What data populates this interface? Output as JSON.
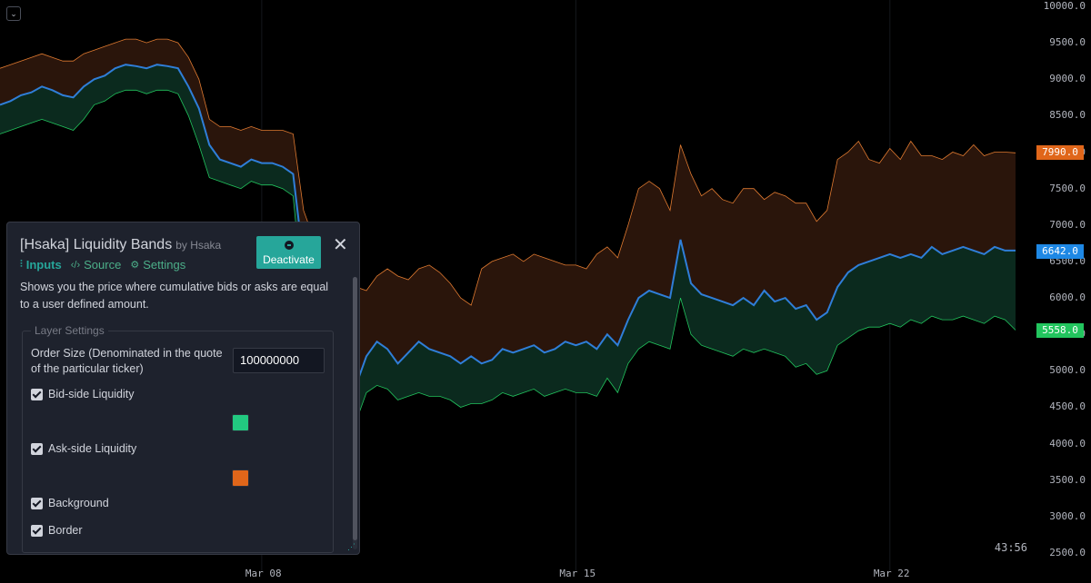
{
  "chart_data": {
    "type": "line",
    "series": [
      {
        "values": [
          8650,
          8700,
          8780,
          8820,
          8900,
          8850,
          8780,
          8750,
          8900,
          9000,
          9050,
          9150,
          9200,
          9180,
          9150,
          9200,
          9180,
          9150,
          8900,
          8600,
          8100,
          7900,
          7850,
          7800,
          7900,
          7850,
          7850,
          7800,
          7700,
          6500,
          5900,
          5500,
          5000,
          4200,
          4800,
          5200,
          5400,
          5300,
          5100,
          5250,
          5400,
          5300,
          5250,
          5200,
          5100,
          5200,
          5100,
          5150,
          5300,
          5250,
          5300,
          5350,
          5250,
          5300,
          5400,
          5350,
          5400,
          5300,
          5500,
          5350,
          5700,
          6000,
          6100,
          6050,
          6000,
          6800,
          6200,
          6050,
          6000,
          5950,
          5900,
          6000,
          5900,
          6100,
          5950,
          6000,
          5850,
          5900,
          5700,
          5800,
          6150,
          6350,
          6450,
          6500,
          6550,
          6600,
          6550,
          6600,
          6550,
          6700,
          6600,
          6650,
          6700,
          6650,
          6600,
          6700,
          6650,
          6650
        ]
      },
      {
        "values": [
          9150,
          9200,
          9250,
          9300,
          9350,
          9300,
          9250,
          9250,
          9350,
          9400,
          9450,
          9500,
          9550,
          9550,
          9500,
          9550,
          9550,
          9500,
          9300,
          9000,
          8450,
          8350,
          8350,
          8300,
          8350,
          8300,
          8300,
          8300,
          8250,
          7200,
          6800,
          6700,
          6550,
          6000,
          6150,
          6100,
          6300,
          6400,
          6300,
          6250,
          6400,
          6450,
          6350,
          6200,
          6000,
          5900,
          6400,
          6500,
          6550,
          6600,
          6500,
          6600,
          6550,
          6500,
          6450,
          6450,
          6400,
          6600,
          6700,
          6550,
          7000,
          7500,
          7600,
          7500,
          7200,
          8100,
          7700,
          7400,
          7500,
          7350,
          7300,
          7500,
          7500,
          7350,
          7450,
          7400,
          7300,
          7300,
          7050,
          7200,
          7900,
          8000,
          8150,
          7900,
          7850,
          8050,
          7900,
          8150,
          7950,
          7950,
          7900,
          8000,
          7950,
          8100,
          7950,
          8000,
          8000,
          7990
        ]
      },
      {
        "values": [
          8250,
          8300,
          8350,
          8400,
          8450,
          8400,
          8350,
          8300,
          8450,
          8650,
          8700,
          8800,
          8850,
          8850,
          8800,
          8850,
          8850,
          8800,
          8500,
          8100,
          7650,
          7600,
          7550,
          7500,
          7600,
          7550,
          7550,
          7500,
          7400,
          5900,
          5100,
          4850,
          4600,
          3400,
          4300,
          4700,
          4800,
          4750,
          4600,
          4650,
          4700,
          4650,
          4650,
          4600,
          4500,
          4550,
          4550,
          4600,
          4700,
          4650,
          4700,
          4750,
          4650,
          4700,
          4750,
          4700,
          4700,
          4650,
          4900,
          4700,
          5100,
          5300,
          5400,
          5350,
          5300,
          6000,
          5500,
          5350,
          5300,
          5250,
          5200,
          5300,
          5250,
          5300,
          5250,
          5200,
          5050,
          5100,
          4950,
          5000,
          5350,
          5450,
          5550,
          5600,
          5600,
          5650,
          5600,
          5700,
          5650,
          5750,
          5700,
          5700,
          5750,
          5700,
          5650,
          5750,
          5700,
          5558
        ]
      }
    ],
    "y_ticks": [
      "10000.0",
      "9500.0",
      "9000.0",
      "8500.0",
      "8000.0",
      "7500.0",
      "7000.0",
      "6500.0",
      "6000.0",
      "5500.0",
      "5000.0",
      "4500.0",
      "4000.0",
      "3500.0",
      "3000.0",
      "2500.0"
    ],
    "ylim": [
      2500,
      10000
    ],
    "x_ticks": [
      "Mar 08",
      "Mar 15",
      "Mar 22"
    ],
    "price_tags": {
      "upper": "7990.0",
      "last": "6642.0",
      "lower": "5558.0"
    },
    "colors": {
      "upper_fill": "#2a150b",
      "upper_line": "#e07a30",
      "lower_fill": "#0b2a1e",
      "lower_line": "#22c55e",
      "price_line": "#2f7ed8",
      "upper_tag": "#e0661a",
      "last_tag": "#1e88e5",
      "lower_tag": "#22c55e"
    },
    "timer": "43:56"
  },
  "panel": {
    "title": "[Hsaka] Liquidity Bands",
    "by": "by Hsaka",
    "deactivate_label": "Deactivate",
    "close_label": "✕",
    "tabs": {
      "inputs": "Inputs",
      "source": "Source",
      "settings": "Settings"
    },
    "description": "Shows you the price where cumulative bids or asks are equal to a user defined amount.",
    "group_title": "Layer Settings",
    "order_size_label": "Order Size (Denominated in the quote of the particular ticker)",
    "order_size_value": "100000000",
    "checkboxes": {
      "bid": "Bid-side Liquidity",
      "ask": "Ask-side Liquidity",
      "background": "Background",
      "border": "Border"
    },
    "bid_color": "#22c980",
    "ask_color": "#e0661a"
  }
}
